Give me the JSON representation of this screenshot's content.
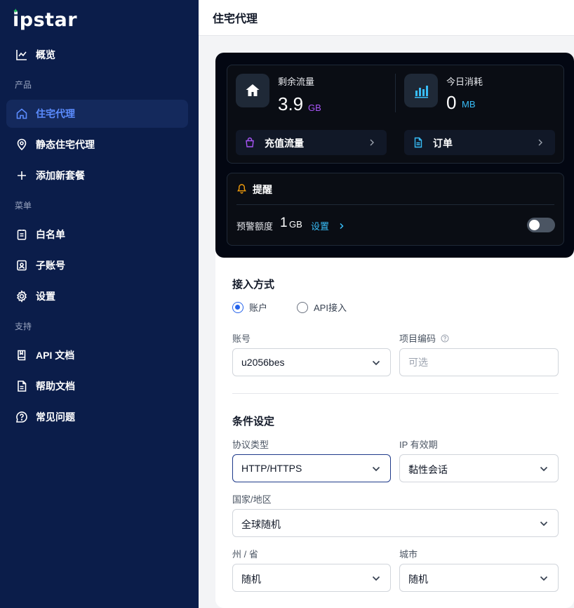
{
  "brand": {
    "name": "ipstar",
    "accent": "#22c55e"
  },
  "sidebar": {
    "items": [
      {
        "label": "概览",
        "icon": "chart-line-icon"
      },
      {
        "label": "住宅代理",
        "icon": "home-icon",
        "active": true
      },
      {
        "label": "静态住宅代理",
        "icon": "map-pin-icon"
      },
      {
        "label": "添加新套餐",
        "icon": "plus-icon"
      },
      {
        "label": "白名单",
        "icon": "clipboard-icon"
      },
      {
        "label": "子账号",
        "icon": "user-badge-icon"
      },
      {
        "label": "设置",
        "icon": "gear-icon"
      },
      {
        "label": "API 文档",
        "icon": "book-icon"
      },
      {
        "label": "帮助文档",
        "icon": "document-icon"
      },
      {
        "label": "常见问题",
        "icon": "question-icon"
      }
    ],
    "groups": {
      "products": "产品",
      "menu": "菜单",
      "support": "支持"
    }
  },
  "header": {
    "title": "住宅代理"
  },
  "stats": {
    "remaining": {
      "label": "剩余流量",
      "value": "3.9",
      "unit": "GB"
    },
    "today": {
      "label": "今日消耗",
      "value": "0",
      "unit": "MB"
    }
  },
  "actions": {
    "recharge": "充值流量",
    "orders": "订单"
  },
  "alert": {
    "title": "提醒",
    "warn_label": "预警额度",
    "warn_value": "1",
    "warn_unit": "GB",
    "set_label": "设置",
    "enabled": false
  },
  "access": {
    "title": "接入方式",
    "options": [
      "账户",
      "API接入"
    ],
    "selected": "账户",
    "account_label": "账号",
    "account_value": "u2056bes",
    "project_label": "项目编码",
    "project_placeholder": "可选"
  },
  "conditions": {
    "title": "条件设定",
    "protocol_label": "协议类型",
    "protocol_value": "HTTP/HTTPS",
    "ip_label": "IP 有效期",
    "ip_value": "黏性会话",
    "country_label": "国家/地区",
    "country_value": "全球随机",
    "state_label": "州 / 省",
    "state_value": "随机",
    "city_label": "城市",
    "city_value": "随机"
  },
  "colors": {
    "sidebar_bg": "#0b1d4a",
    "active_text": "#5b8cff",
    "gb_unit": "#a855f7",
    "mb_unit": "#38bdf8",
    "bell": "#f59e0b"
  }
}
